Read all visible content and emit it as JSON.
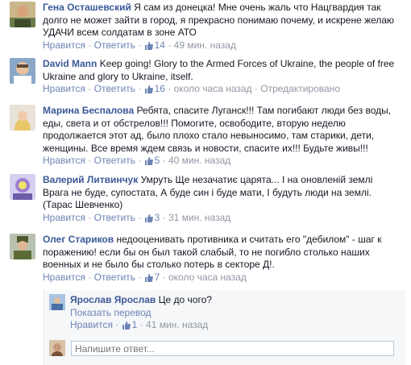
{
  "comments": [
    {
      "author": "Гена Осташевский",
      "text": "Я сам из донецка! Мне очень жаль что Нацгвардия так долго не может зайти в город, я прекрасно понимаю почему, и искрене желаю УДАЧИ всем солдатам в зоне АТО",
      "like_label": "Нравится",
      "reply_label": "Ответить",
      "likes": "14",
      "time": "49 мин. назад",
      "edited": ""
    },
    {
      "author": "David Mann",
      "text": "Keep going! Glory to the Armed Forces of Ukraine, the people of free Ukraine and glory to Ukraine, itself.",
      "like_label": "Нравится",
      "reply_label": "Ответить",
      "likes": "16",
      "time": "около часа назад",
      "edited": "Отредактировано"
    },
    {
      "author": "Марина Беспалова",
      "text": "Ребята, спасите Луганск!!! Там погибают люди без воды, еды, света и от обстрелов!!! Помогите, освободите, вторую неделю продолжается этот ад, было плохо стало невыносимо, там старики, дети, женщины. Все время ждем связь и новости, спасите их!!! Будьте живы!!!",
      "like_label": "Нравится",
      "reply_label": "Ответить",
      "likes": "5",
      "time": "40 мин. назад",
      "edited": ""
    },
    {
      "author": "Валерий Литвинчук",
      "text": "Умруть Ще незачатиє царята... І на оновленій землі Врага не буде, супостата, А буде син і буде мати, І будуть люди на землі. (Тарас Шевченко)",
      "like_label": "Нравится",
      "reply_label": "Ответить",
      "likes": "3",
      "time": "31 мин. назад",
      "edited": ""
    },
    {
      "author": "Олег Стариков",
      "text": "недооценивать противника и считать его \"дебилом\" - шаг к поражению! если бы он был такой слабый, то не погибло столько наших военных и не было бы столько потерь в секторе Д!.",
      "like_label": "Нравится",
      "reply_label": "Ответить",
      "likes": "7",
      "time": "около часа назад",
      "edited": ""
    }
  ],
  "reply": {
    "author": "Ярослав Ярослав",
    "text": "Це до чого?",
    "translate_label": "Показать перевод",
    "like_label": "Нравится",
    "likes": "1",
    "time": "41 мин. назад"
  },
  "reply_input": {
    "placeholder": "Напишите ответ..."
  },
  "colors": {
    "link": "#3b5998",
    "meta": "#9197a3",
    "action": "#6d84b4",
    "reply_bg": "#f6f7f9"
  }
}
